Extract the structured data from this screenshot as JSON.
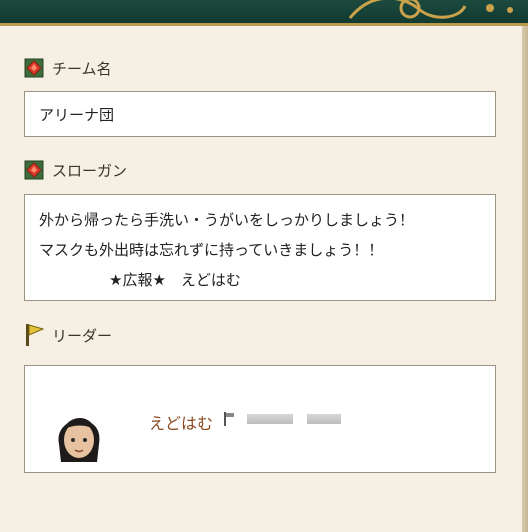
{
  "header": {
    "title_fragment": "",
    "background_color": "#153f35",
    "ornament_color": "#c9a24a"
  },
  "team_name_section": {
    "label": "チーム名",
    "icon": "red-gem-icon",
    "value": "アリーナ団"
  },
  "slogan_section": {
    "label": "スローガン",
    "icon": "red-gem-icon",
    "lines": [
      "外から帰ったら手洗い・うがいをしっかりしましょう！",
      "マスクも外出時は忘れずに持っていきましょう！！",
      "★広報★　えどはむ"
    ]
  },
  "leader_section": {
    "label": "リーダー",
    "icon": "yellow-flag-icon",
    "leader_name": "えどはむ",
    "avatar": "character-avatar-icon",
    "status_icon": "small-flag-icon",
    "name_color": "#8a4b22"
  }
}
